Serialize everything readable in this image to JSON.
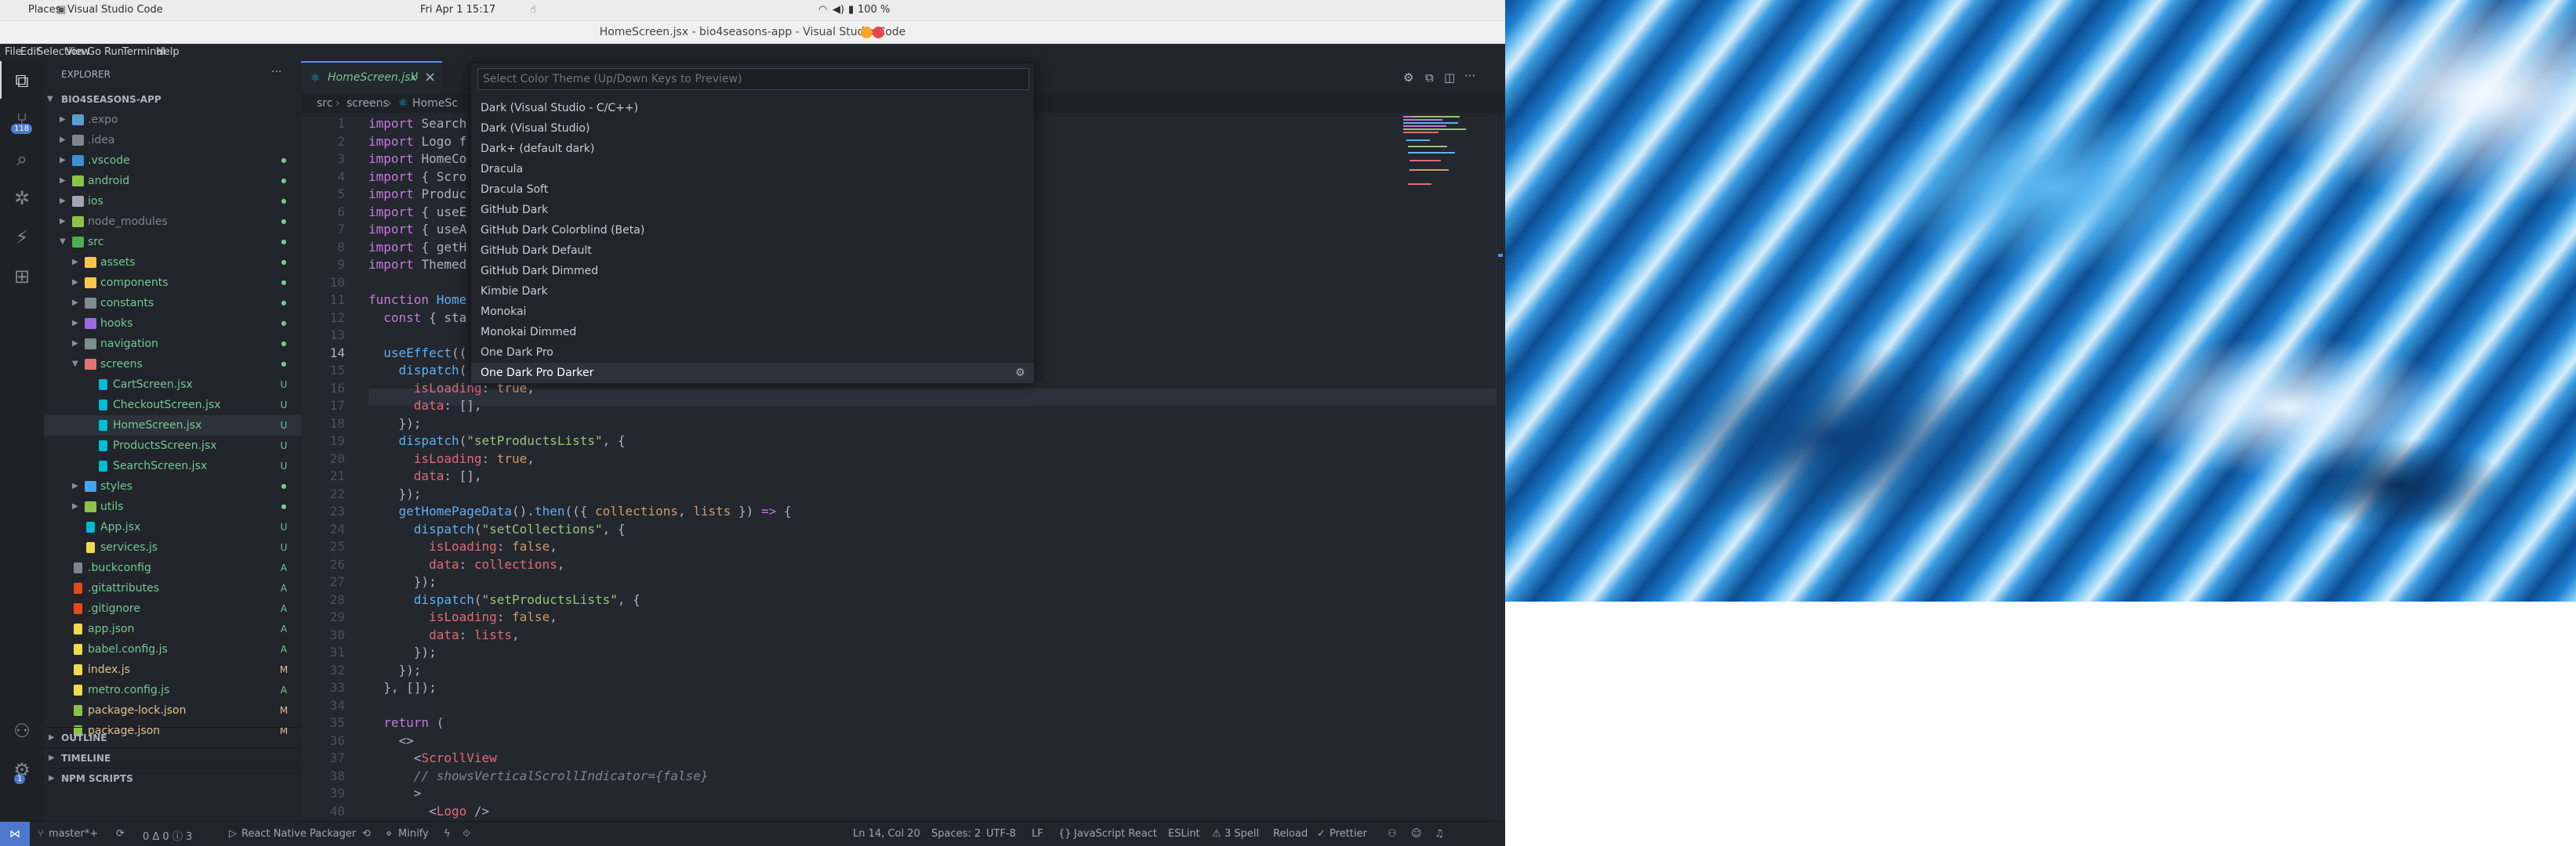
{
  "topbar": {
    "places": "Places",
    "app": "Visual Studio Code",
    "clock": "Fri Apr 1  15:17",
    "battery": "100 %"
  },
  "window": {
    "title": "HomeScreen.jsx - bio4seasons-app - Visual Studio Code"
  },
  "menu": [
    "File",
    "Edit",
    "Selection",
    "View",
    "Go",
    "Run",
    "Terminal",
    "Help"
  ],
  "activity": {
    "scm_badge": "118",
    "accounts_badge": "1"
  },
  "sidebar": {
    "title": "EXPLORER",
    "more": "···",
    "root": "BIO4SEASONS-APP",
    "tree": [
      {
        "label": "expo",
        "prefix": ".",
        "indent": 0,
        "type": "folder",
        "color": "#5c9ecf",
        "label_color": "#7f848e",
        "badge": "",
        "badge_color": ""
      },
      {
        "label": ".idea",
        "prefix": "",
        "indent": 0,
        "type": "folder",
        "color": "#7f848e",
        "label_color": "#7f848e",
        "badge": "",
        "badge_color": ""
      },
      {
        "label": ".vscode",
        "prefix": "",
        "indent": 0,
        "type": "folder",
        "color": "#3d8fd6",
        "label_color": "#73c991",
        "badge": "●",
        "badge_color": "#73c991"
      },
      {
        "label": "android",
        "prefix": "",
        "indent": 0,
        "type": "folder",
        "color": "#8bc34a",
        "label_color": "#73c991",
        "badge": "●",
        "badge_color": "#73c991"
      },
      {
        "label": "ios",
        "prefix": "",
        "indent": 0,
        "type": "folder",
        "color": "#a0a7b4",
        "label_color": "#73c991",
        "badge": "●",
        "badge_color": "#73c991"
      },
      {
        "label": "node_modules",
        "prefix": "",
        "indent": 0,
        "type": "folder",
        "color": "#8bc34a",
        "label_color": "#7f848e",
        "badge": "●",
        "badge_color": "#73c991"
      },
      {
        "label": "src",
        "prefix": "",
        "indent": 0,
        "type": "folder-open",
        "color": "#4caf50",
        "label_color": "#73c991",
        "badge": "●",
        "badge_color": "#73c991"
      },
      {
        "label": "assets",
        "prefix": "",
        "indent": 1,
        "type": "folder",
        "color": "#f9c74f",
        "label_color": "#73c991",
        "badge": "●",
        "badge_color": "#73c991"
      },
      {
        "label": "components",
        "prefix": "",
        "indent": 1,
        "type": "folder",
        "color": "#f9c74f",
        "label_color": "#73c991",
        "badge": "●",
        "badge_color": "#73c991"
      },
      {
        "label": "constants",
        "prefix": "",
        "indent": 1,
        "type": "folder",
        "color": "#7f8c8d",
        "label_color": "#73c991",
        "badge": "●",
        "badge_color": "#73c991"
      },
      {
        "label": "hooks",
        "prefix": "",
        "indent": 1,
        "type": "folder",
        "color": "#9c6ade",
        "label_color": "#73c991",
        "badge": "●",
        "badge_color": "#73c991"
      },
      {
        "label": "navigation",
        "prefix": "",
        "indent": 1,
        "type": "folder",
        "color": "#7f8c8d",
        "label_color": "#73c991",
        "badge": "●",
        "badge_color": "#73c991"
      },
      {
        "label": "screens",
        "prefix": "",
        "indent": 1,
        "type": "folder-open",
        "color": "#e57373",
        "label_color": "#73c991",
        "badge": "●",
        "badge_color": "#73c991"
      },
      {
        "label": "CartScreen.jsx",
        "prefix": "",
        "indent": 2,
        "type": "react",
        "color": "#00bcd4",
        "label_color": "#73c991",
        "badge": "U",
        "badge_color": "#73c991"
      },
      {
        "label": "CheckoutScreen.jsx",
        "prefix": "",
        "indent": 2,
        "type": "react",
        "color": "#00bcd4",
        "label_color": "#73c991",
        "badge": "U",
        "badge_color": "#73c991"
      },
      {
        "label": "HomeScreen.jsx",
        "prefix": "",
        "indent": 2,
        "type": "react",
        "color": "#00bcd4",
        "label_color": "#73c991",
        "badge": "U",
        "badge_color": "#73c991",
        "selected": true
      },
      {
        "label": "ProductsScreen.jsx",
        "prefix": "",
        "indent": 2,
        "type": "react",
        "color": "#00bcd4",
        "label_color": "#73c991",
        "badge": "U",
        "badge_color": "#73c991"
      },
      {
        "label": "SearchScreen.jsx",
        "prefix": "",
        "indent": 2,
        "type": "react",
        "color": "#00bcd4",
        "label_color": "#73c991",
        "badge": "U",
        "badge_color": "#73c991"
      },
      {
        "label": "styles",
        "prefix": "",
        "indent": 1,
        "type": "folder",
        "color": "#42a5f5",
        "label_color": "#73c991",
        "badge": "●",
        "badge_color": "#73c991"
      },
      {
        "label": "utils",
        "prefix": "",
        "indent": 1,
        "type": "folder",
        "color": "#8bc34a",
        "label_color": "#73c991",
        "badge": "●",
        "badge_color": "#73c991"
      },
      {
        "label": "App.jsx",
        "prefix": "",
        "indent": 1,
        "type": "react",
        "color": "#00bcd4",
        "label_color": "#73c991",
        "badge": "U",
        "badge_color": "#73c991"
      },
      {
        "label": "services.js",
        "prefix": "",
        "indent": 1,
        "type": "js",
        "color": "#f0db4f",
        "label_color": "#73c991",
        "badge": "U",
        "badge_color": "#73c991"
      },
      {
        "label": ".buckconfig",
        "prefix": "",
        "indent": 0,
        "type": "file",
        "color": "#7f848e",
        "label_color": "#73c991",
        "badge": "A",
        "badge_color": "#73c991"
      },
      {
        "label": ".gitattributes",
        "prefix": "",
        "indent": 0,
        "type": "git",
        "color": "#e64a19",
        "label_color": "#73c991",
        "badge": "A",
        "badge_color": "#73c991"
      },
      {
        "label": ".gitignore",
        "prefix": "",
        "indent": 0,
        "type": "git",
        "color": "#e64a19",
        "label_color": "#73c991",
        "badge": "A",
        "badge_color": "#73c991"
      },
      {
        "label": "app.json",
        "prefix": "",
        "indent": 0,
        "type": "json",
        "color": "#f0db4f",
        "label_color": "#73c991",
        "badge": "A",
        "badge_color": "#73c991"
      },
      {
        "label": "babel.config.js",
        "prefix": "",
        "indent": 0,
        "type": "babel",
        "color": "#f0db4f",
        "label_color": "#73c991",
        "badge": "A",
        "badge_color": "#73c991"
      },
      {
        "label": "index.js",
        "prefix": "",
        "indent": 0,
        "type": "js",
        "color": "#f0db4f",
        "label_color": "#e2c08d",
        "badge": "M",
        "badge_color": "#e2c08d"
      },
      {
        "label": "metro.config.js",
        "prefix": "",
        "indent": 0,
        "type": "js",
        "color": "#f0db4f",
        "label_color": "#73c991",
        "badge": "A",
        "badge_color": "#73c991"
      },
      {
        "label": "package-lock.json",
        "prefix": "",
        "indent": 0,
        "type": "npm",
        "color": "#8bc34a",
        "label_color": "#e2c08d",
        "badge": "M",
        "badge_color": "#e2c08d"
      },
      {
        "label": "package.json",
        "prefix": "",
        "indent": 0,
        "type": "npm",
        "color": "#8bc34a",
        "label_color": "#e2c08d",
        "badge": "M",
        "badge_color": "#e2c08d"
      }
    ],
    "sections": [
      "OUTLINE",
      "TIMELINE",
      "NPM SCRIPTS"
    ]
  },
  "tab": {
    "name": "HomeScreen.jsx",
    "status": "U",
    "close": "×"
  },
  "breadcrumb": [
    "src",
    "screens",
    "HomeSc"
  ],
  "quickpick": {
    "placeholder": "Select Color Theme (Up/Down Keys to Preview)",
    "options": [
      "Dark (Visual Studio - C/C++)",
      "Dark (Visual Studio)",
      "Dark+ (default dark)",
      "Dracula",
      "Dracula Soft",
      "GitHub Dark",
      "GitHub Dark Colorblind (Beta)",
      "GitHub Dark Default",
      "GitHub Dark Dimmed",
      "Kimbie Dark",
      "Monokai",
      "Monokai Dimmed",
      "One Dark Pro",
      "One Dark Pro Darker"
    ],
    "selected_index": 13
  },
  "code": [
    {
      "n": "1",
      "t": [
        [
          "kw",
          "import "
        ],
        [
          "pn",
          "Search"
        ]
      ]
    },
    {
      "n": "2",
      "t": [
        [
          "kw",
          "import "
        ],
        [
          "pn",
          "Logo f"
        ]
      ]
    },
    {
      "n": "3",
      "t": [
        [
          "kw",
          "import "
        ],
        [
          "pn",
          "HomeCo"
        ]
      ]
    },
    {
      "n": "4",
      "t": [
        [
          "kw",
          "import "
        ],
        [
          "pn",
          "{ Scro"
        ]
      ]
    },
    {
      "n": "5",
      "t": [
        [
          "kw",
          "import "
        ],
        [
          "pn",
          "Produc"
        ]
      ]
    },
    {
      "n": "6",
      "t": [
        [
          "kw",
          "import "
        ],
        [
          "pn",
          "{ useE"
        ]
      ]
    },
    {
      "n": "7",
      "t": [
        [
          "kw",
          "import "
        ],
        [
          "pn",
          "{ useA"
        ]
      ]
    },
    {
      "n": "8",
      "t": [
        [
          "kw",
          "import "
        ],
        [
          "pn",
          "{ getH"
        ]
      ]
    },
    {
      "n": "9",
      "t": [
        [
          "kw",
          "import "
        ],
        [
          "pn",
          "Themed"
        ],
        [
          "pn",
          "                                     \";"
        ]
      ]
    },
    {
      "n": "10",
      "t": []
    },
    {
      "n": "11",
      "t": [
        [
          "kw",
          "function "
        ],
        [
          "fn",
          "Home"
        ]
      ]
    },
    {
      "n": "12",
      "t": [
        [
          "pn",
          "  "
        ],
        [
          "kw",
          "const "
        ],
        [
          "pn",
          "{ sta"
        ]
      ]
    },
    {
      "n": "13",
      "t": []
    },
    {
      "n": "14",
      "t": [
        [
          "pn",
          "  "
        ],
        [
          "fn",
          "useEffect"
        ],
        [
          "pn",
          "(("
        ]
      ]
    },
    {
      "n": "15",
      "t": [
        [
          "pn",
          "    "
        ],
        [
          "fn",
          "dispatch"
        ],
        [
          "pn",
          "("
        ]
      ]
    },
    {
      "n": "16",
      "t": [
        [
          "pn",
          "      "
        ],
        [
          "tg",
          "isLoading"
        ],
        [
          "pn",
          ": "
        ],
        [
          "nm",
          "true"
        ],
        [
          "pn",
          ","
        ]
      ]
    },
    {
      "n": "17",
      "t": [
        [
          "pn",
          "      "
        ],
        [
          "tg",
          "data"
        ],
        [
          "pn",
          ": [],"
        ]
      ]
    },
    {
      "n": "18",
      "t": [
        [
          "pn",
          "    });"
        ]
      ]
    },
    {
      "n": "19",
      "t": [
        [
          "pn",
          "    "
        ],
        [
          "fn",
          "dispatch"
        ],
        [
          "pn",
          "("
        ],
        [
          "st",
          "\"setProductsLists\""
        ],
        [
          "pn",
          ", {"
        ]
      ]
    },
    {
      "n": "20",
      "t": [
        [
          "pn",
          "      "
        ],
        [
          "tg",
          "isLoading"
        ],
        [
          "pn",
          ": "
        ],
        [
          "nm",
          "true"
        ],
        [
          "pn",
          ","
        ]
      ]
    },
    {
      "n": "21",
      "t": [
        [
          "pn",
          "      "
        ],
        [
          "tg",
          "data"
        ],
        [
          "pn",
          ": [],"
        ]
      ]
    },
    {
      "n": "22",
      "t": [
        [
          "pn",
          "    });"
        ]
      ]
    },
    {
      "n": "23",
      "t": [
        [
          "pn",
          "    "
        ],
        [
          "fn",
          "getHomePageData"
        ],
        [
          "pn",
          "()."
        ],
        [
          "fn",
          "then"
        ],
        [
          "pn",
          "(({ "
        ],
        [
          "nm",
          "collections"
        ],
        [
          "pn",
          ", "
        ],
        [
          "nm",
          "lists"
        ],
        [
          "pn",
          " }) "
        ],
        [
          "kw",
          "=>"
        ],
        [
          "pn",
          " {"
        ]
      ]
    },
    {
      "n": "24",
      "t": [
        [
          "pn",
          "      "
        ],
        [
          "fn",
          "dispatch"
        ],
        [
          "pn",
          "("
        ],
        [
          "st",
          "\"setCollections\""
        ],
        [
          "pn",
          ", {"
        ]
      ]
    },
    {
      "n": "25",
      "t": [
        [
          "pn",
          "        "
        ],
        [
          "tg",
          "isLoading"
        ],
        [
          "pn",
          ": "
        ],
        [
          "nm",
          "false"
        ],
        [
          "pn",
          ","
        ]
      ]
    },
    {
      "n": "26",
      "t": [
        [
          "pn",
          "        "
        ],
        [
          "tg",
          "data"
        ],
        [
          "pn",
          ": "
        ],
        [
          "tg",
          "collections"
        ],
        [
          "pn",
          ","
        ]
      ]
    },
    {
      "n": "27",
      "t": [
        [
          "pn",
          "      });"
        ]
      ]
    },
    {
      "n": "28",
      "t": [
        [
          "pn",
          "      "
        ],
        [
          "fn",
          "dispatch"
        ],
        [
          "pn",
          "("
        ],
        [
          "st",
          "\"setProductsLists\""
        ],
        [
          "pn",
          ", {"
        ]
      ]
    },
    {
      "n": "29",
      "t": [
        [
          "pn",
          "        "
        ],
        [
          "tg",
          "isLoading"
        ],
        [
          "pn",
          ": "
        ],
        [
          "nm",
          "false"
        ],
        [
          "pn",
          ","
        ]
      ]
    },
    {
      "n": "30",
      "t": [
        [
          "pn",
          "        "
        ],
        [
          "tg",
          "data"
        ],
        [
          "pn",
          ": "
        ],
        [
          "tg",
          "lists"
        ],
        [
          "pn",
          ","
        ]
      ]
    },
    {
      "n": "31",
      "t": [
        [
          "pn",
          "      });"
        ]
      ]
    },
    {
      "n": "32",
      "t": [
        [
          "pn",
          "    });"
        ]
      ]
    },
    {
      "n": "33",
      "t": [
        [
          "pn",
          "  }, []);"
        ]
      ]
    },
    {
      "n": "34",
      "t": []
    },
    {
      "n": "35",
      "t": [
        [
          "pn",
          "  "
        ],
        [
          "kw",
          "return"
        ],
        [
          "pn",
          " ("
        ]
      ]
    },
    {
      "n": "36",
      "t": [
        [
          "pn",
          "    <>"
        ]
      ]
    },
    {
      "n": "37",
      "t": [
        [
          "pn",
          "      <"
        ],
        [
          "tg",
          "ScrollView"
        ]
      ]
    },
    {
      "n": "38",
      "t": [
        [
          "cm",
          "      // showsVerticalScrollIndicator={false}"
        ]
      ]
    },
    {
      "n": "39",
      "t": [
        [
          "pn",
          "      >"
        ]
      ]
    },
    {
      "n": "40",
      "t": [
        [
          "pn",
          "        <"
        ],
        [
          "tg",
          "Logo"
        ],
        [
          "pn",
          " />"
        ]
      ]
    }
  ],
  "statusbar": {
    "branch": "master*+",
    "problems": "0 Δ 0 ⓘ 3",
    "packager": "React Native Packager",
    "minify": "Minify",
    "position": "Ln 14, Col 20",
    "spaces": "Spaces: 2",
    "encoding": "UTF-8",
    "eol": "LF",
    "language": "JavaScript React",
    "eslint": "ESLint",
    "spell": "3 Spell",
    "reload": "Reload",
    "prettier": "Prettier"
  },
  "colors": {
    "accent": "#528bff",
    "added": "#73c991",
    "modified": "#e2c08d",
    "remote": "#4d78cc"
  }
}
